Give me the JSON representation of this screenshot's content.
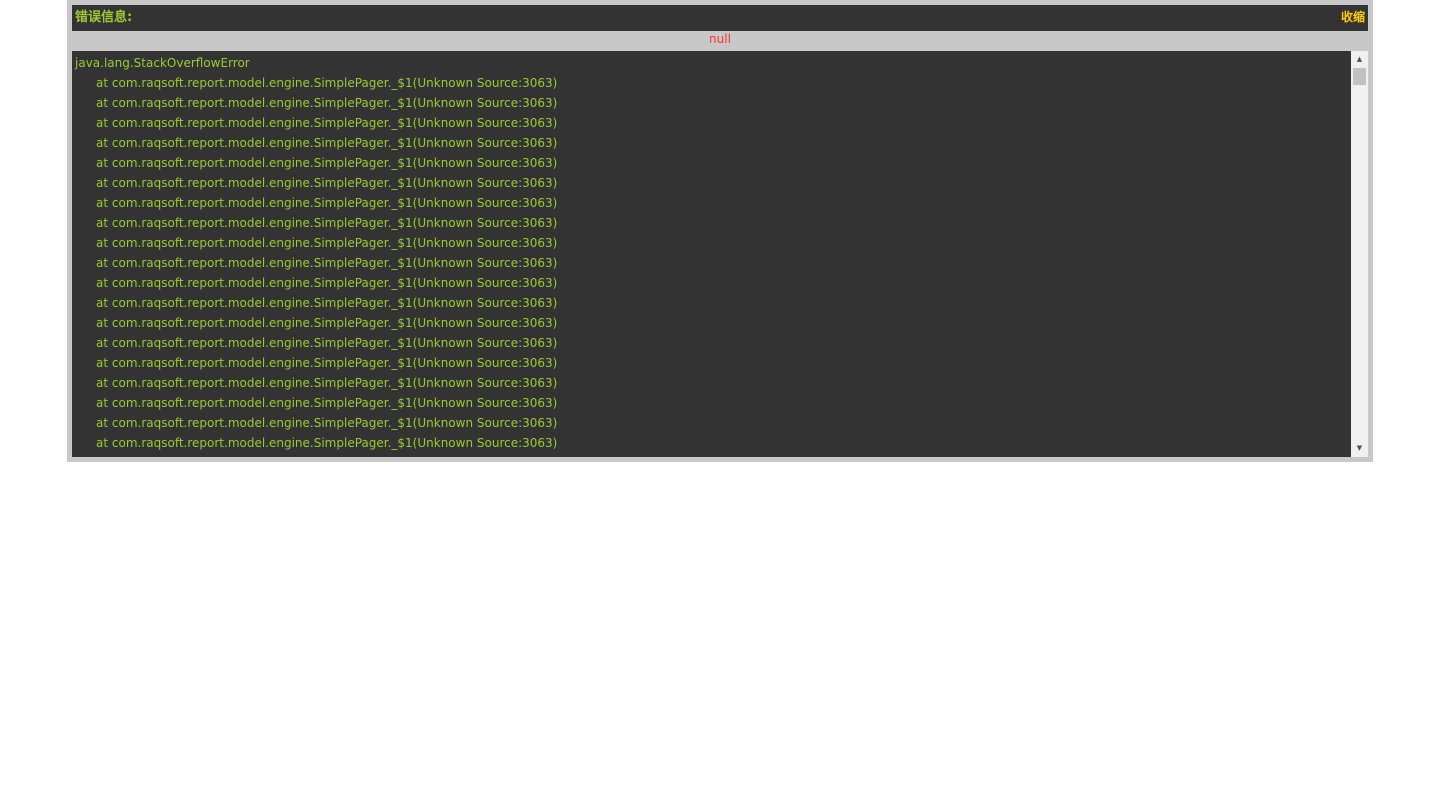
{
  "header": {
    "title": "错误信息:",
    "collapse_label": "收缩"
  },
  "message": "null",
  "trace": {
    "exception": "java.lang.StackOverflowError",
    "frames": [
      "at com.raqsoft.report.model.engine.SimplePager._$1(Unknown Source:3063)",
      "at com.raqsoft.report.model.engine.SimplePager._$1(Unknown Source:3063)",
      "at com.raqsoft.report.model.engine.SimplePager._$1(Unknown Source:3063)",
      "at com.raqsoft.report.model.engine.SimplePager._$1(Unknown Source:3063)",
      "at com.raqsoft.report.model.engine.SimplePager._$1(Unknown Source:3063)",
      "at com.raqsoft.report.model.engine.SimplePager._$1(Unknown Source:3063)",
      "at com.raqsoft.report.model.engine.SimplePager._$1(Unknown Source:3063)",
      "at com.raqsoft.report.model.engine.SimplePager._$1(Unknown Source:3063)",
      "at com.raqsoft.report.model.engine.SimplePager._$1(Unknown Source:3063)",
      "at com.raqsoft.report.model.engine.SimplePager._$1(Unknown Source:3063)",
      "at com.raqsoft.report.model.engine.SimplePager._$1(Unknown Source:3063)",
      "at com.raqsoft.report.model.engine.SimplePager._$1(Unknown Source:3063)",
      "at com.raqsoft.report.model.engine.SimplePager._$1(Unknown Source:3063)",
      "at com.raqsoft.report.model.engine.SimplePager._$1(Unknown Source:3063)",
      "at com.raqsoft.report.model.engine.SimplePager._$1(Unknown Source:3063)",
      "at com.raqsoft.report.model.engine.SimplePager._$1(Unknown Source:3063)",
      "at com.raqsoft.report.model.engine.SimplePager._$1(Unknown Source:3063)",
      "at com.raqsoft.report.model.engine.SimplePager._$1(Unknown Source:3063)",
      "at com.raqsoft.report.model.engine.SimplePager._$1(Unknown Source:3063)"
    ]
  },
  "scrollbar": {
    "up_icon": "triangle-up",
    "down_icon": "triangle-down"
  },
  "colors": {
    "panel_border": "#c8c8c8",
    "dark_background": "#333333",
    "trace_text": "#99cc33",
    "collapse_text": "#ffcc00",
    "message_text": "#ff3333"
  }
}
